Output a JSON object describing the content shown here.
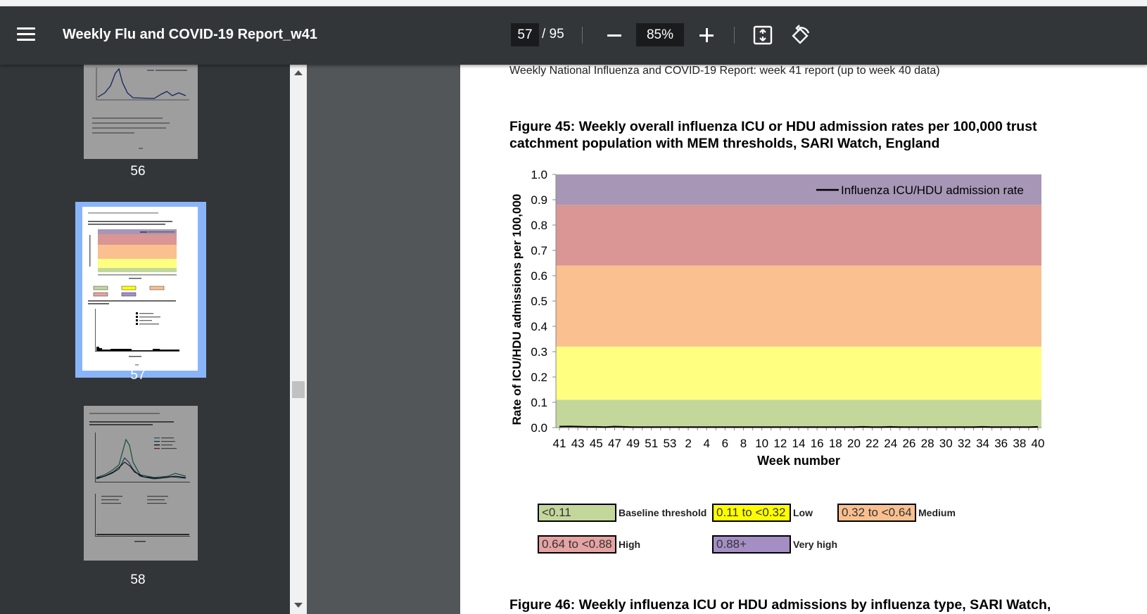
{
  "toolbar": {
    "title": "Weekly Flu and COVID-19 Report_w41",
    "current_page": "57",
    "total_pages": "/ 95",
    "zoom": "85%"
  },
  "sidebar": {
    "thumbnails": [
      {
        "page": "56"
      },
      {
        "page": "57",
        "selected": true
      },
      {
        "page": "58"
      }
    ]
  },
  "page": {
    "running_head": "Weekly National Influenza and COVID-19 Report: week 41 report (up to week 40 data)",
    "figure_title": "Figure 45: Weekly overall influenza ICU or HDU admission rates per 100,000 trust catchment population with MEM thresholds, SARI Watch, England",
    "next_figure_title": "Figure 46: Weekly influenza ICU or HDU admissions by influenza type, SARI Watch,"
  },
  "legend_keys": [
    {
      "range": "<0.11",
      "label": "Baseline threshold",
      "color": "#c4d79b"
    },
    {
      "range": "0.11 to <0.32",
      "label": "Low",
      "color": "#ffff00"
    },
    {
      "range": "0.32 to <0.64",
      "label": "Medium",
      "color": "#fabf8f"
    },
    {
      "range": "0.64 to <0.88",
      "label": "High",
      "color": "#e6a3a3"
    },
    {
      "range": "0.88+",
      "label": "Very high",
      "color": "#a48ec4"
    }
  ],
  "chart_data": {
    "type": "line",
    "title": "",
    "xlabel": "Week number",
    "ylabel": "Rate of ICU/HDU admissions per 100,000",
    "ylim": [
      0,
      1.0
    ],
    "yticks": [
      "0.0",
      "0.1",
      "0.2",
      "0.3",
      "0.4",
      "0.5",
      "0.6",
      "0.7",
      "0.8",
      "0.9",
      "1.0"
    ],
    "x": [
      "41",
      "42",
      "43",
      "44",
      "45",
      "46",
      "47",
      "48",
      "49",
      "50",
      "51",
      "52",
      "53",
      "1",
      "2",
      "3",
      "4",
      "5",
      "6",
      "7",
      "8",
      "9",
      "10",
      "11",
      "12",
      "13",
      "14",
      "15",
      "16",
      "17",
      "18",
      "19",
      "20",
      "21",
      "22",
      "23",
      "24",
      "25",
      "26",
      "27",
      "28",
      "29",
      "30",
      "31",
      "32",
      "33",
      "34",
      "35",
      "36",
      "37",
      "38",
      "39",
      "40"
    ],
    "xtick_labels": [
      "41",
      "43",
      "45",
      "47",
      "49",
      "51",
      "53",
      "2",
      "4",
      "6",
      "8",
      "10",
      "12",
      "14",
      "16",
      "18",
      "20",
      "22",
      "24",
      "26",
      "28",
      "30",
      "32",
      "34",
      "36",
      "38",
      "40"
    ],
    "legend_position": "top-right",
    "series": [
      {
        "name": "Influenza ICU/HDU admission rate",
        "color": "#000000",
        "values": [
          0.004,
          0.005,
          0.004,
          0.003,
          0.003,
          0.002,
          0.004,
          0.003,
          0.002,
          0.002,
          0.002,
          0.002,
          0.002,
          0.002,
          0.002,
          0.002,
          0.002,
          0.002,
          0.002,
          0.002,
          0.002,
          0.002,
          0.002,
          0.002,
          0.002,
          0.002,
          0.002,
          0.002,
          0.002,
          0.002,
          0.002,
          0.002,
          0.002,
          0.003,
          0.002,
          0.002,
          0.003,
          0.002,
          0.002,
          0.002,
          0.002,
          0.002,
          0.002,
          0.002,
          0.002,
          0.002,
          0.003,
          0.002,
          0.002,
          0.002,
          0.002,
          0.002,
          0.003
        ]
      }
    ],
    "threshold_bands": [
      {
        "from": 0.0,
        "to": 0.11,
        "color": "#c4d79b"
      },
      {
        "from": 0.11,
        "to": 0.32,
        "color": "#ffff80"
      },
      {
        "from": 0.32,
        "to": 0.64,
        "color": "#fac090"
      },
      {
        "from": 0.64,
        "to": 0.88,
        "color": "#da9694"
      },
      {
        "from": 0.88,
        "to": 1.0,
        "color": "#a796b5"
      }
    ]
  }
}
